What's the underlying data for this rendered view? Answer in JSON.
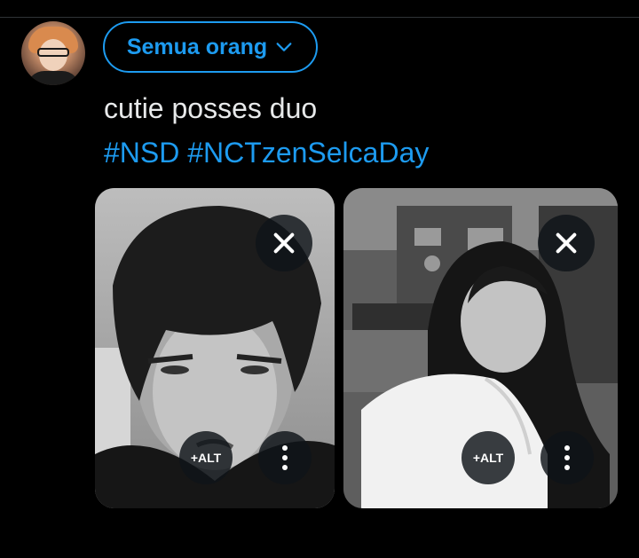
{
  "composer": {
    "audience_label": "Semua orang",
    "audience_icon": "chevron-down-icon",
    "avatar_icon": "user-avatar",
    "text": "cutie posses duo",
    "hashtags": [
      "#NSD",
      "#NCTzenSelcaDay"
    ]
  },
  "media": [
    {
      "description_icon": "photo",
      "close_icon": "close-icon",
      "alt_label": "+ALT",
      "more_icon": "more-vertical-icon"
    },
    {
      "description_icon": "photo",
      "close_icon": "close-icon",
      "alt_label": "+ALT",
      "more_icon": "more-vertical-icon"
    }
  ],
  "colors": {
    "background": "#000000",
    "accent": "#1d9bf0",
    "text": "#e7e9ea",
    "overlay_button": "#0f1419"
  }
}
